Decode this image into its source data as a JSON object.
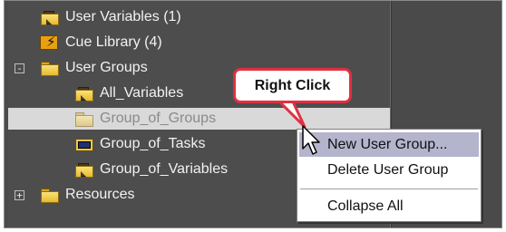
{
  "tree": {
    "items": [
      {
        "label": "User Variables (1)",
        "icon": "variable-folder-icon"
      },
      {
        "label": "Cue Library (4)",
        "icon": "lightning-icon"
      },
      {
        "label": "User Groups",
        "icon": "folder-icon",
        "expander": "-"
      },
      {
        "label": "All_Variables",
        "icon": "variable-folder-icon"
      },
      {
        "label": "Group_of_Groups",
        "icon": "folder-icon",
        "selected": true
      },
      {
        "label": "Group_of_Tasks",
        "icon": "task-folder-icon"
      },
      {
        "label": "Group_of_Variables",
        "icon": "variable-folder-icon"
      },
      {
        "label": "Resources",
        "icon": "folder-icon",
        "expander": "+"
      }
    ]
  },
  "callout": {
    "text": "Right Click",
    "border_color": "#e03040"
  },
  "context_menu": {
    "items": [
      {
        "label": "New User Group...",
        "highlighted": true
      },
      {
        "label": "Delete User Group"
      },
      {
        "label": "Collapse All"
      }
    ]
  },
  "lightning_glyph": "⚡"
}
